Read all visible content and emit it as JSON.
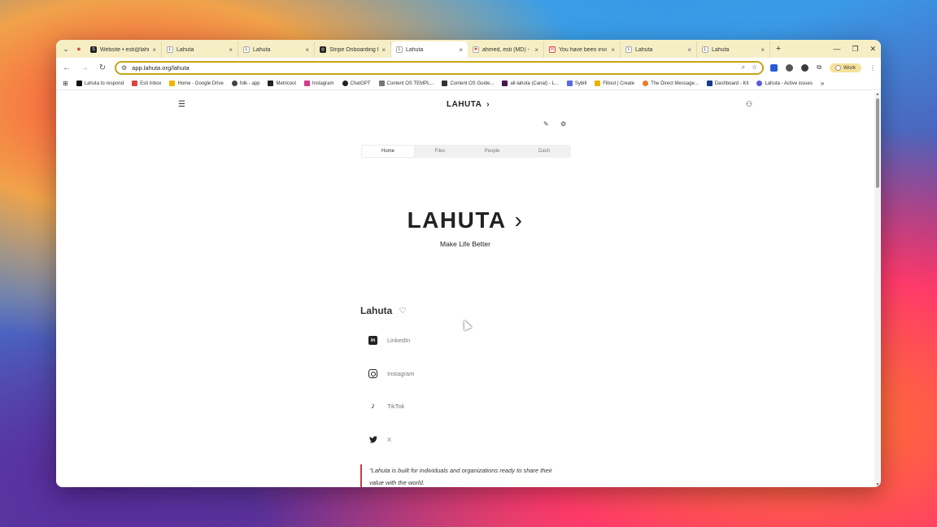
{
  "browser": {
    "tabs": [
      {
        "label": "Website • esti@lahu",
        "fav": "dark",
        "fav_text": "S"
      },
      {
        "label": "Lahuta",
        "fav": "plain",
        "fav_text": "L"
      },
      {
        "label": "Lahuta",
        "fav": "plain",
        "fav_text": "L"
      },
      {
        "label": "Stripe Onboarding f",
        "fav": "dark",
        "fav_text": "◎"
      },
      {
        "label": "Lahuta",
        "fav": "plain",
        "fav_text": "L"
      },
      {
        "label": "ahmed, esti (MD) - L",
        "fav": "plain",
        "fav_text": "✱"
      },
      {
        "label": "You have been invi",
        "fav": "gm",
        "fav_text": "M"
      },
      {
        "label": "Lahuta",
        "fav": "plain",
        "fav_text": "L"
      },
      {
        "label": "Lahuta",
        "fav": "plain",
        "fav_text": "L"
      }
    ],
    "new_tab_symbol": "+",
    "url": "app.lahuta.org/lahuta",
    "profile_label": "Work",
    "bookmarks": [
      "Lahuta to respond",
      "Esti Inbox",
      "Home - Google Drive",
      "folk - app",
      "Metricool",
      "Instagram",
      "ChatGPT",
      "Content OS TEMPL...",
      "Content OS Guide...",
      "all-lahuta (Canal) - L...",
      "Sybill",
      "Fillout | Create",
      "The Direct Message...",
      "Dashboard - Kit",
      "Lahuta - Active issues"
    ],
    "bookmarks_more": "»"
  },
  "page": {
    "brand": "LAHUTA",
    "brand_chevron": "›",
    "tabs": [
      "Home",
      "Files",
      "People",
      "Dash"
    ],
    "active_tab": 0,
    "hero_title": "LAHUTA",
    "hero_chevron": "›",
    "hero_subtitle": "Make Life Better",
    "profile_name": "Lahuta",
    "links": [
      {
        "label": "LinkedIn",
        "icon": "linkedin-icon"
      },
      {
        "label": "Instagram",
        "icon": "instagram-icon"
      },
      {
        "label": "TikTok",
        "icon": "tiktok-icon"
      },
      {
        "label": "X",
        "icon": "twitter-icon"
      }
    ],
    "quote_line1": "\"Lahuta is built for individuals and organizations ready to share their",
    "quote_line2": "value with the world."
  }
}
